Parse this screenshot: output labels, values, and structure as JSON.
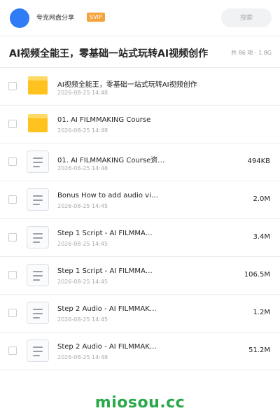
{
  "header": {
    "username": "夸克网盘分享",
    "badge": "SVIP",
    "search_placeholder": "搜索"
  },
  "page": {
    "title": "AI视频全能王，零基础一站式玩转AI视频创作",
    "meta": "共 86 项 · 1.8G"
  },
  "files": [
    {
      "type": "folder",
      "name": "AI视频全能王，零基础一站式玩转AI视频创作",
      "date": "2026-08-25 14:48",
      "size": ""
    },
    {
      "type": "folder",
      "name": "01. AI FILMMAKING Course",
      "date": "2026-08-25 14:48",
      "size": ""
    },
    {
      "type": "file",
      "name": "01. AI FILMMAKING Course资…",
      "date": "2026-08-25 14:48",
      "size": "494KB"
    },
    {
      "type": "file",
      "name": "Bonus How to add audio vi…",
      "date": "2026-08-25 14:45",
      "size": "2.0M"
    },
    {
      "type": "file",
      "name": "Step 1 Script - AI FILMMA…",
      "date": "2026-08-25 14:45",
      "size": "3.4M"
    },
    {
      "type": "file",
      "name": "Step 1 Script - AI FILMMA…",
      "date": "2026-08-25 14:45",
      "size": "106.5M"
    },
    {
      "type": "file",
      "name": "Step 2 Audio - AI FILMMAK…",
      "date": "2026-08-25 14:45",
      "size": "1.2M"
    },
    {
      "type": "file",
      "name": "Step 2 Audio - AI FILMMAK…",
      "date": "2026-08-25 14:48",
      "size": "51.2M"
    }
  ],
  "watermark": "miosou.cc"
}
